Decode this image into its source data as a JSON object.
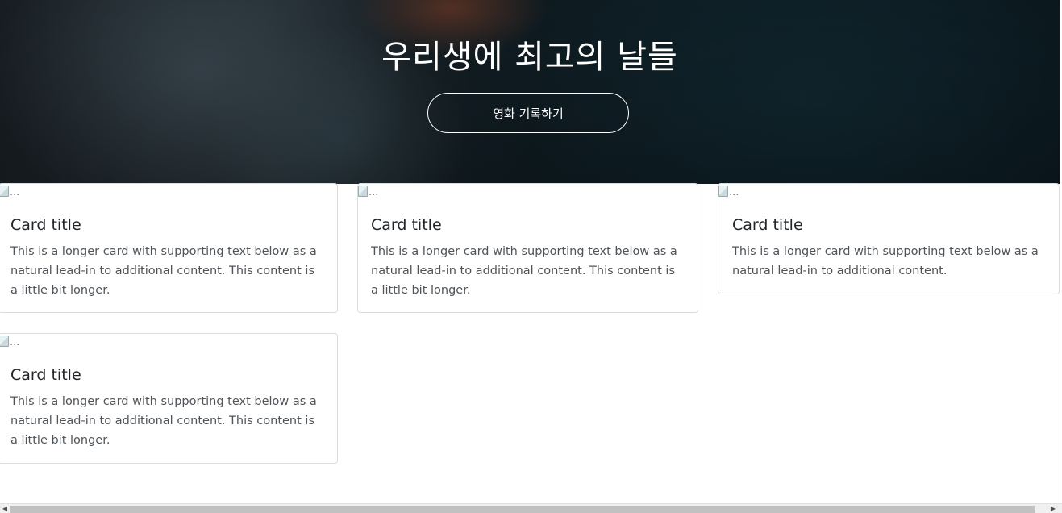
{
  "hero": {
    "title": "우리생에 최고의 날들",
    "button_label": "영화 기록하기"
  },
  "cards": [
    {
      "img_alt": "...",
      "title": "Card title",
      "text": "This is a longer card with supporting text below as a natural lead-in to additional content. This content is a little bit longer."
    },
    {
      "img_alt": "...",
      "title": "Card title",
      "text": "This is a longer card with supporting text below as a natural lead-in to additional content. This content is a little bit longer."
    },
    {
      "img_alt": "...",
      "title": "Card title",
      "text": "This is a longer card with supporting text below as a natural lead-in to additional content."
    },
    {
      "img_alt": "...",
      "title": "Card title",
      "text": "This is a longer card with supporting text below as a natural lead-in to additional content. This content is a little bit longer."
    }
  ],
  "scrollbar": {
    "left_arrow": "◀",
    "right_arrow": "▶"
  }
}
